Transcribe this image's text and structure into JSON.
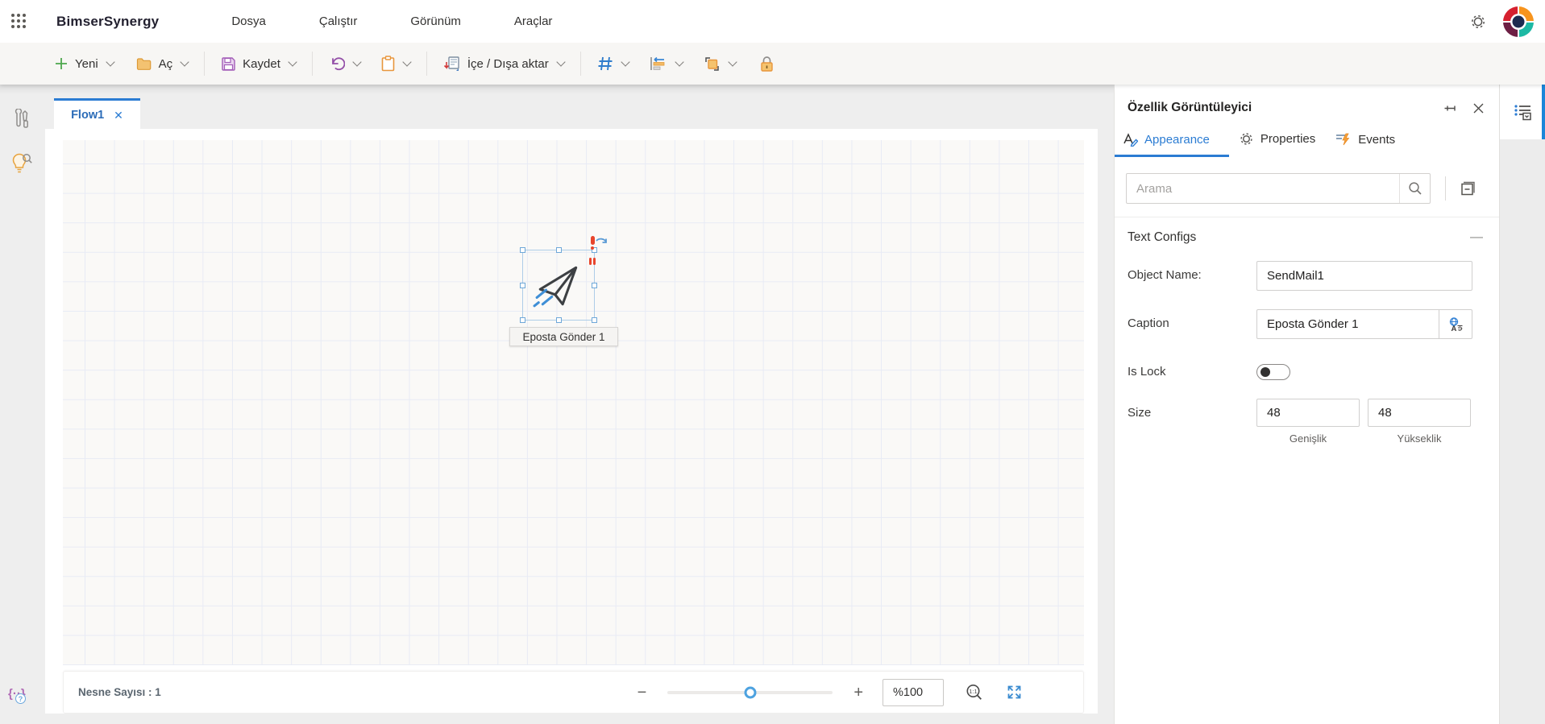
{
  "topbar": {
    "brand": "BimserSynergy",
    "menus": [
      {
        "label": "Dosya"
      },
      {
        "label": "Çalıştır"
      },
      {
        "label": "Görünüm"
      },
      {
        "label": "Araçlar"
      }
    ]
  },
  "toolbar": {
    "new_label": "Yeni",
    "open_label": "Aç",
    "save_label": "Kaydet",
    "import_export_label": "İçe / Dışa aktar"
  },
  "tab": {
    "label": "Flow1",
    "close": "✕"
  },
  "canvas": {
    "node_caption": "Eposta Gönder 1"
  },
  "statusbar": {
    "object_count": "Nesne Sayısı : 1",
    "zoom_value": "%100",
    "minus": "−",
    "plus": "+"
  },
  "panel": {
    "title": "Özellik Görüntüleyici",
    "tabs": [
      {
        "label": "Appearance"
      },
      {
        "label": "Properties"
      },
      {
        "label": "Events"
      }
    ],
    "search_placeholder": "Arama",
    "section_title": "Text Configs",
    "collapse_glyph": "—",
    "fields": {
      "object_name_label": "Object Name:",
      "object_name_value": "SendMail1",
      "caption_label": "Caption",
      "caption_value": "Eposta Gönder 1",
      "islock_label": "Is Lock",
      "size_label": "Size",
      "width_value": "48",
      "height_value": "48",
      "width_sub": "Genişlik",
      "height_sub": "Yükseklik"
    }
  },
  "icons": {
    "waffle": "app-launcher",
    "gear": "settings",
    "avatar": "bimser-logo",
    "plus": "new",
    "folder": "open",
    "floppy": "save",
    "undo": "undo",
    "clipboard": "paste",
    "import_export": "documents-arrows",
    "grid": "grid",
    "align": "align-left",
    "group": "group",
    "lock": "lock",
    "tools": "toolbox",
    "bulb_search": "discover",
    "braces_help": "script-help",
    "pin": "pin-panel",
    "close": "close-panel",
    "appearance": "a-pencil",
    "properties": "gear",
    "events": "lines-lightning",
    "search": "magnifier",
    "collapse_all": "box-minus",
    "translate": "globe-a",
    "zoom_actual": "magnifier-1:1",
    "zoom_fit": "expand-arrows",
    "panel_list": "property-list"
  },
  "colors": {
    "accent_blue": "#2b7cd3",
    "tab_blue": "#2b6cb8",
    "green": "#4ca64c",
    "amber": "#e9a23b",
    "purple": "#a04fc0",
    "orange": "#e8963c",
    "red_handle": "#e8452c",
    "logo_red": "#d6202f",
    "logo_orange": "#f7941d",
    "logo_teal": "#1db9a4",
    "logo_maroon": "#6d1f44",
    "logo_navy": "#1d2b4f"
  }
}
